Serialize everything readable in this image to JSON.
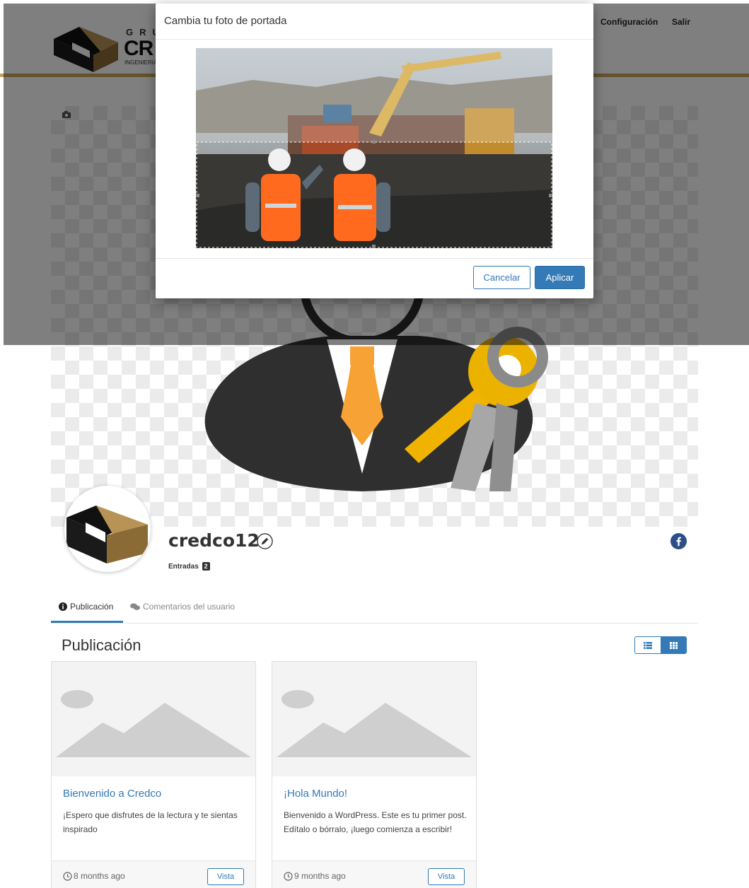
{
  "header": {
    "logo_top": "GRU",
    "logo_main": "CR",
    "logo_sub": "INGENIERIA,",
    "nav": [
      {
        "label": "Configuración"
      },
      {
        "label": "Salir"
      }
    ]
  },
  "profile": {
    "username": "credco123",
    "posts_label": "Entradas",
    "posts_count": "2"
  },
  "tabs": [
    {
      "label": "Publicación",
      "active": true
    },
    {
      "label": "Comentarios del usuario",
      "active": false
    }
  ],
  "section": {
    "title": "Publicación"
  },
  "posts": [
    {
      "title": "Bienvenido a Credco",
      "excerpt": "¡Espero que disfrutes de la lectura y te sientas inspirado",
      "time": "8 months ago",
      "button": "Vista"
    },
    {
      "title": "¡Hola Mundo!",
      "excerpt": "Bienvenido a WordPress. Este es tu primer post. Edítalo o bórralo, ¡luego comienza a escribir!",
      "time": "9 months ago",
      "button": "Vista"
    }
  ],
  "modal": {
    "title": "Cambia tu foto de portada",
    "cancel_label": "Cancelar",
    "apply_label": "Aplicar"
  },
  "colors": {
    "accent": "#337ab7",
    "brand_gold": "#c7a45a",
    "overlay": "rgba(0,0,0,0.5)"
  },
  "icons": [
    "camera-icon",
    "pencil-icon",
    "facebook-icon",
    "info-icon",
    "comments-icon",
    "list-view-icon",
    "grid-view-icon",
    "clock-icon"
  ]
}
